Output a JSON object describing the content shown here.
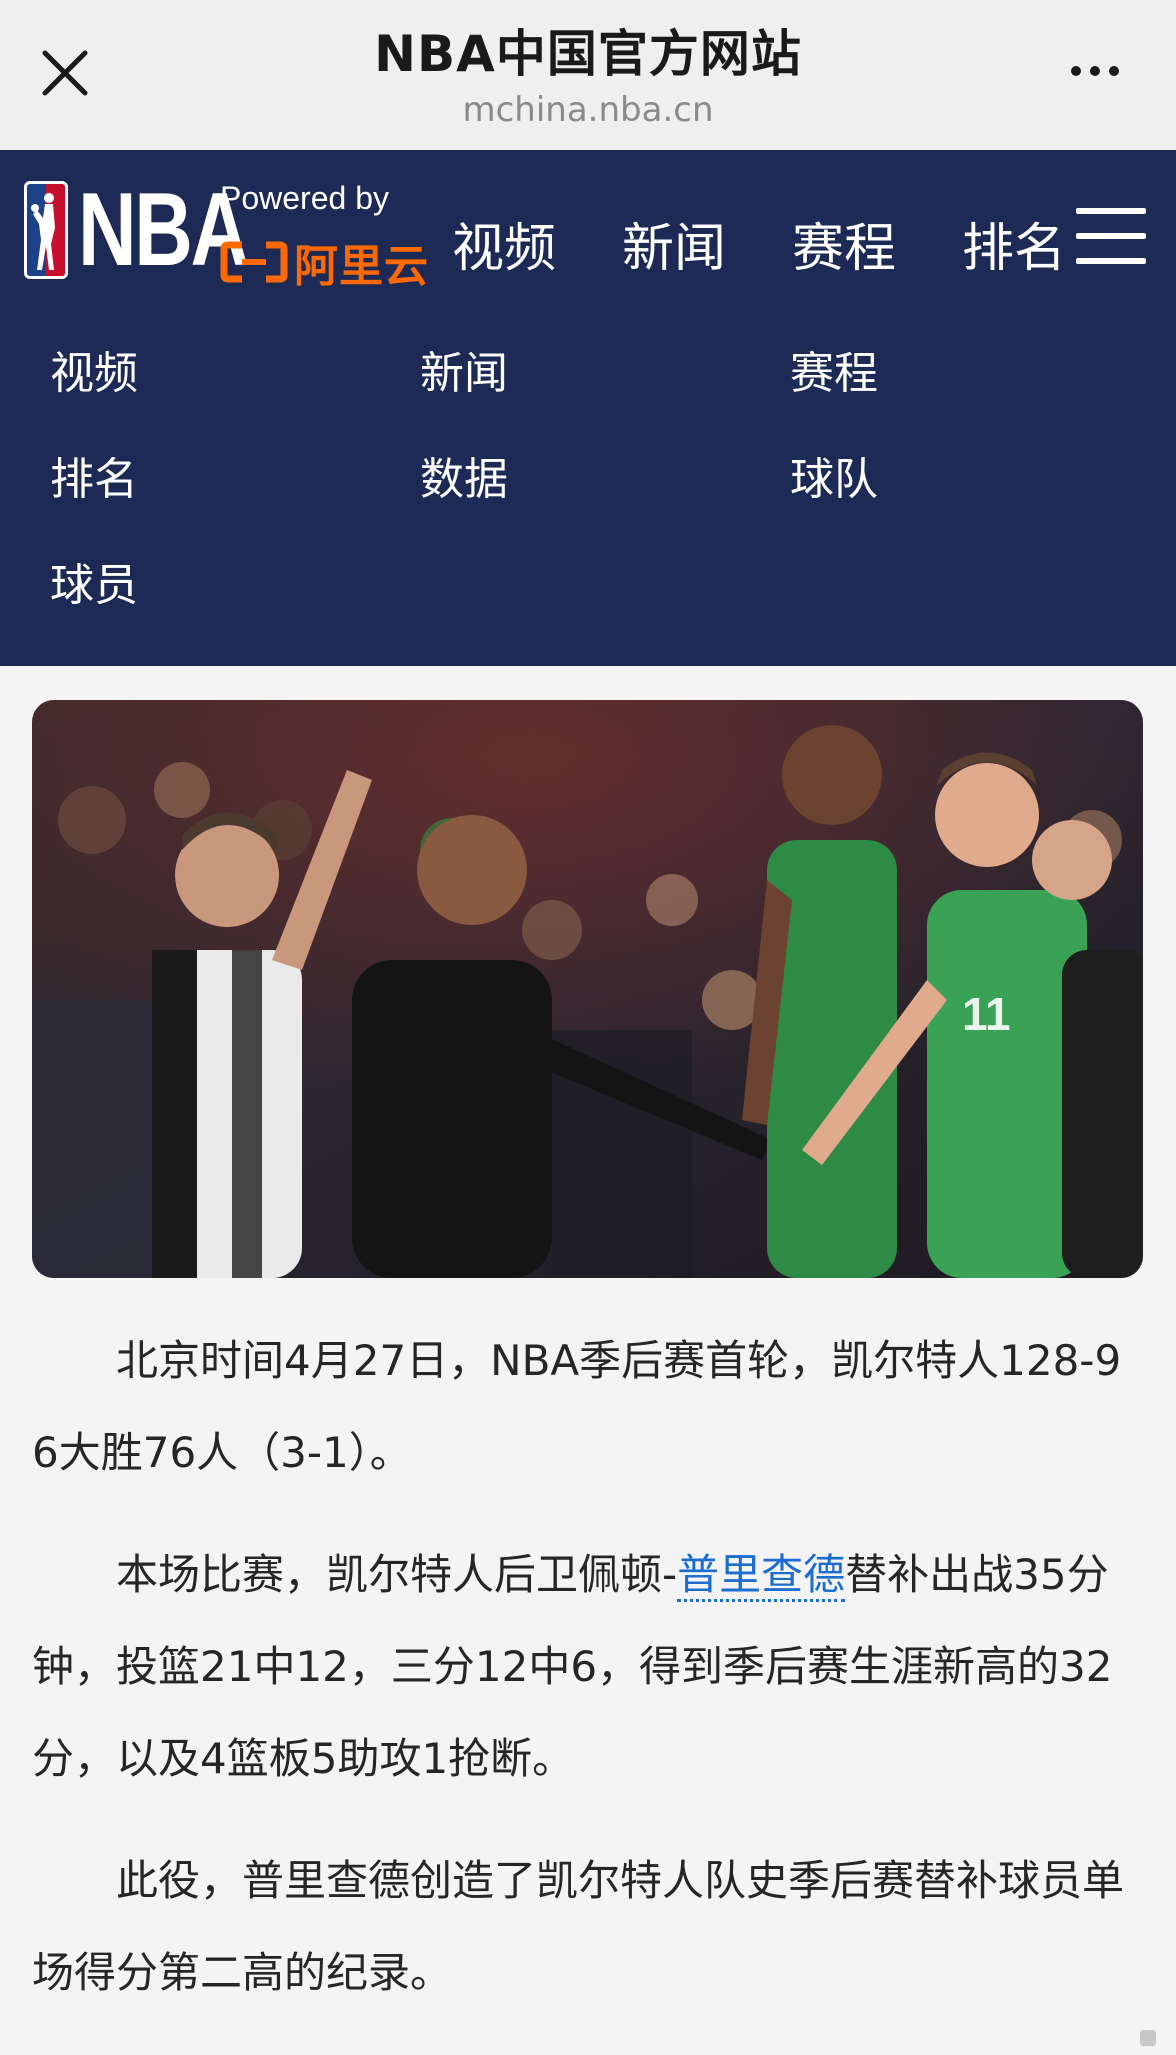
{
  "browser": {
    "title": "NBA中国官方网站",
    "domain": "mchina.nba.cn",
    "close_icon": "close-icon",
    "more_icon": "more-dots-icon"
  },
  "header": {
    "logo_text": "NBA",
    "powered_by": "Powered by",
    "partner": "阿里云",
    "nav": [
      {
        "label": "视频"
      },
      {
        "label": "新闻"
      },
      {
        "label": "赛程"
      },
      {
        "label": "排名"
      }
    ],
    "menu_icon": "hamburger-menu-icon",
    "colors": {
      "background": "#1d2a56",
      "partner_orange": "#ff6a00",
      "logo_red": "#c8102e",
      "logo_blue": "#1d428a"
    }
  },
  "dropdown": {
    "items": [
      {
        "label": "视频"
      },
      {
        "label": "新闻"
      },
      {
        "label": "赛程"
      },
      {
        "label": "排名"
      },
      {
        "label": "数据"
      },
      {
        "label": "球队"
      },
      {
        "label": "球员"
      }
    ]
  },
  "article": {
    "image_alt": "referee, coach and Celtics players courtside",
    "p1": "北京时间4月27日，NBA季后赛首轮，凯尔特人128-96大胜76人（3-1）。",
    "p2_before": "本场比赛，凯尔特人后卫佩顿-",
    "p2_link": "普里查德",
    "p2_after": "替补出战35分钟，投篮21中12，三分12中6，得到季后赛生涯新高的32分，以及4篮板5助攻1抢断。",
    "p3": "此役，普里查德创造了凯尔特人队史季后赛替补球员单场得分第二高的纪录。",
    "link_color": "#1b6dd1"
  }
}
